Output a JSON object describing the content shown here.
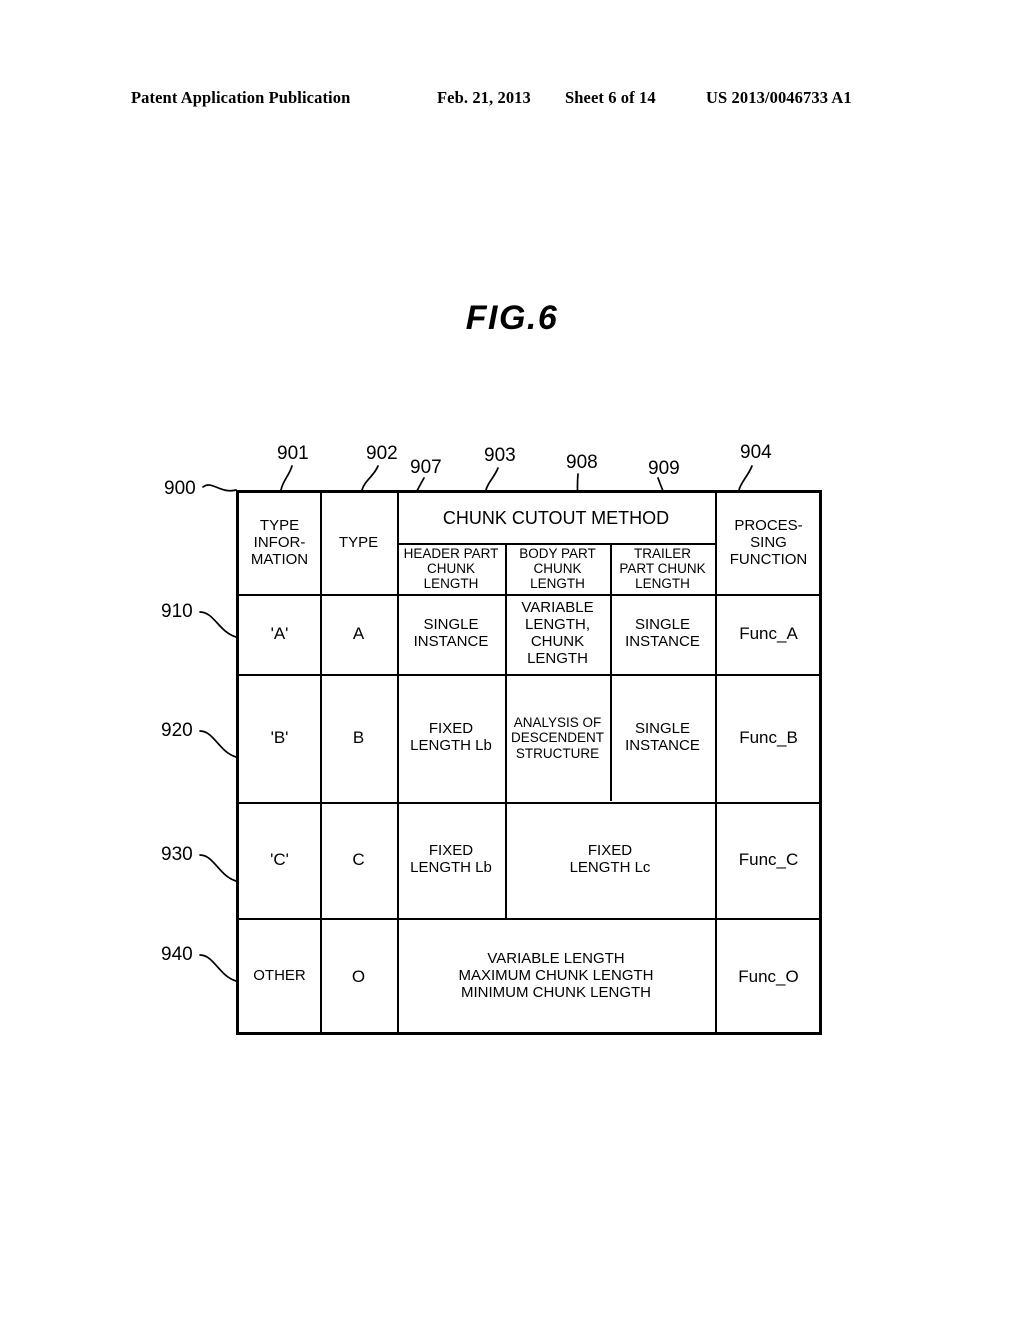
{
  "page_header": {
    "publication": "Patent Application Publication",
    "date": "Feb. 21, 2013",
    "sheet": "Sheet 6 of 14",
    "patent_number": "US 2013/0046733 A1"
  },
  "figure": {
    "title": "FIG.6",
    "reference_numbers": {
      "table": "900",
      "col_type_information": "901",
      "col_type": "902",
      "group_chunk_cutout_method": "903",
      "col_processing_function": "904",
      "col_header_part_chunk_length": "907",
      "col_body_part_chunk_length": "908",
      "col_trailer_part_chunk_length": "909",
      "row_a": "910",
      "row_b": "920",
      "row_c": "930",
      "row_other": "940"
    }
  },
  "table": {
    "group_header": "CHUNK CUTOUT METHOD",
    "columns": [
      {
        "key": "type_information",
        "label": "TYPE\nINFOR-\nMATION"
      },
      {
        "key": "type",
        "label": "TYPE"
      },
      {
        "key": "header_part",
        "label": "HEADER PART\nCHUNK\nLENGTH"
      },
      {
        "key": "body_part",
        "label": "BODY PART\nCHUNK\nLENGTH"
      },
      {
        "key": "trailer_part",
        "label": "TRAILER\nPART CHUNK\nLENGTH"
      },
      {
        "key": "processing_function",
        "label": "PROCES-\nSING\nFUNCTION"
      }
    ],
    "header_labels": {
      "type_information": "TYPE\nINFOR-\nMATION",
      "type": "TYPE",
      "header_part": "HEADER PART\nCHUNK\nLENGTH",
      "body_part": "BODY PART\nCHUNK\nLENGTH",
      "trailer_part": "TRAILER\nPART CHUNK\nLENGTH",
      "processing_function": "PROCES-\nSING\nFUNCTION"
    },
    "rows": [
      {
        "ref": "910",
        "type_information": "'A'",
        "type": "A",
        "header_part": "SINGLE\nINSTANCE",
        "body_part": "VARIABLE\nLENGTH,\nCHUNK\nLENGTH",
        "trailer_part": "SINGLE\nINSTANCE",
        "processing_function": "Func_A"
      },
      {
        "ref": "920",
        "type_information": "'B'",
        "type": "B",
        "header_part": "FIXED\nLENGTH Lb",
        "body_part": "ANALYSIS OF\nDESCENDENT\nSTRUCTURE",
        "trailer_part": "SINGLE\nINSTANCE",
        "processing_function": "Func_B"
      },
      {
        "ref": "930",
        "type_information": "'C'",
        "type": "C",
        "header_part": "FIXED\nLENGTH Lb",
        "body_trailer_merged": "FIXED\nLENGTH Lc",
        "processing_function": "Func_C"
      },
      {
        "ref": "940",
        "type_information": "OTHER",
        "type": "O",
        "chunk_merged": "VARIABLE LENGTH\nMAXIMUM CHUNK LENGTH\nMINIMUM CHUNK LENGTH",
        "processing_function": "Func_O"
      }
    ]
  }
}
